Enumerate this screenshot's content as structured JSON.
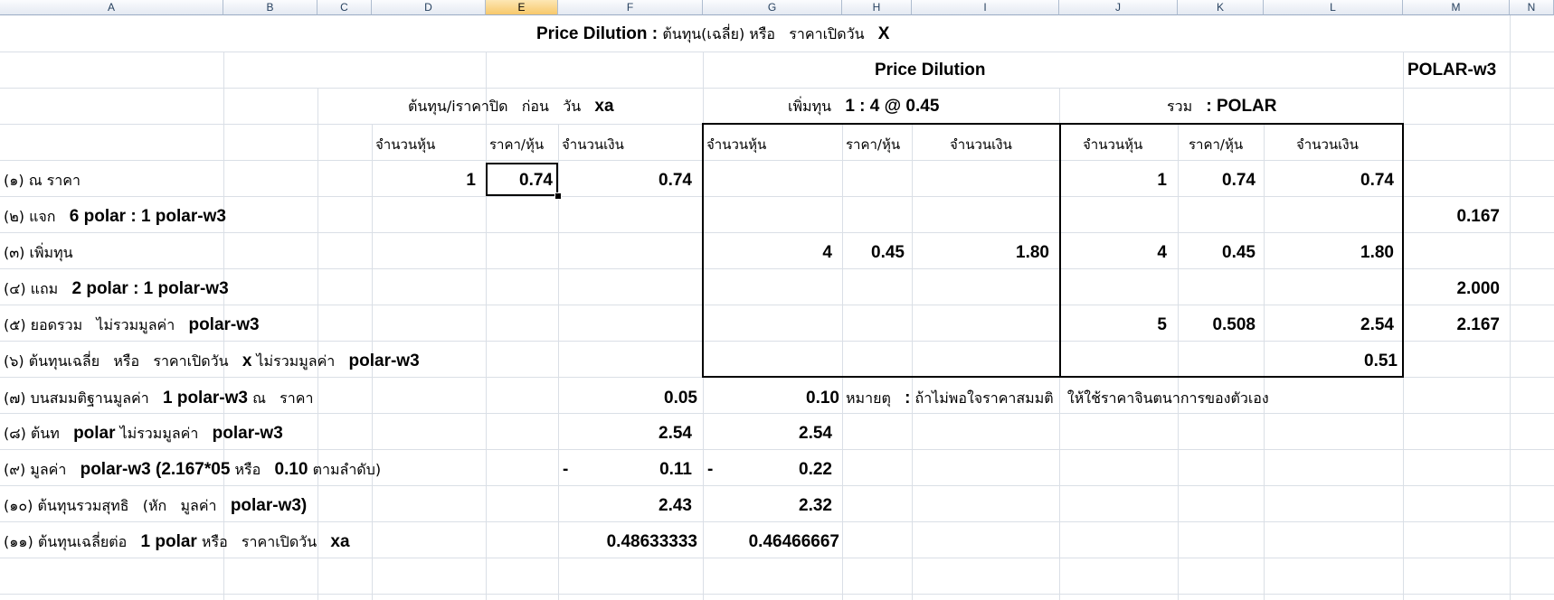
{
  "columns": [
    "A",
    "B",
    "C",
    "D",
    "E",
    "F",
    "G",
    "H",
    "I",
    "J",
    "K",
    "L",
    "M",
    "N"
  ],
  "title": {
    "en": "Price Dilution",
    "sep": " : ",
    "rest": "ต้นทุน(เฉลี่ย) หรือ   ราคาเปิดวัน   ",
    "x": "X"
  },
  "row2": {
    "price_dilution": "Price Dilution",
    "polar_w3": "POLAR-w3"
  },
  "row3": {
    "left_label": "ต้นทุน/iราคาปิด   ก่อน   วัน",
    "left_xa": "xa",
    "mid_label": "เพิ่มทุน",
    "mid_ratio": "1 : 4 @ 0.45",
    "right_label": "รวม",
    "right_polar": ": POLAR"
  },
  "headers": {
    "d": "จำนวนหุ้น",
    "e": "ราคา/หุ้น",
    "f": "จำนวนเงิน",
    "g": "จำนวนหุ้น",
    "h": "ราคา/หุ้น",
    "i": "จำนวนเงิน",
    "j": "จำนวนหุ้น",
    "k": "ราคา/หุ้น",
    "l": "จำนวนเงิน"
  },
  "rows": {
    "r1": {
      "a_th": "(๑) ณ   ราคา",
      "d": "1",
      "e": "0.74",
      "f": "0.74",
      "j": "1",
      "k": "0.74",
      "l": "0.74"
    },
    "r2": {
      "a_th": "(๒) แจก",
      "a_en": "6 polar : 1 polar-w3",
      "m": "0.167"
    },
    "r3": {
      "a_th": "(๓) เพิ่มทุน",
      "g": "4",
      "h": "0.45",
      "i": "1.80",
      "j": "4",
      "k": "0.45",
      "l": "1.80"
    },
    "r4": {
      "a_th": "(๔) แถม",
      "a_en": "2 polar : 1 polar-w3",
      "m": "2.000"
    },
    "r5": {
      "a_th": "(๕) ยอดรวม   ไม่รวมมูลค่า",
      "a_en": "polar-w3",
      "j": "5",
      "k": "0.508",
      "l": "2.54",
      "m": "2.167"
    },
    "r6": {
      "a_th": "(๖) ต้นทุนเฉลี่ย   หรือ   ราคาเปิดวัน",
      "a_x": "x",
      "a_th2": "ไม่รวมมูลค่า",
      "a_en": "polar-w3",
      "l": "0.51"
    },
    "r7": {
      "a_th": "(๗) บนสมมติฐานมูลค่า",
      "a_en": "1 polar-w3",
      "a_th2": "ณ   ราคา",
      "f": "0.05",
      "g": "0.10",
      "note_label": "หมายตุ",
      "note_colon": ":",
      "note_text": "ถ้าไม่พอใจราคาสมมติ   ให้ใช้ราคาจินตนาการของตัวเอง"
    },
    "r8": {
      "a_th": "(๘) ต้นท",
      "a_en": "polar",
      "a_th2": "ไม่รวมมูลค่า",
      "a_en2": "polar-w3",
      "f": "2.54",
      "g": "2.54"
    },
    "r9": {
      "a_th": "(๙) มูลค่า",
      "a_en": "polar-w3 (2.167*05",
      "a_th2": "หรือ",
      "a_en2": "0.10",
      "a_th3": "ตามลำดับ)",
      "f_dash": "-",
      "f": "0.11",
      "g_dash": "-",
      "g": "0.22"
    },
    "r10": {
      "a_th": "(๑๐) ต้นทุนรวมสุทธิ   (หัก   มูลค่า",
      "a_en": "polar-w3)",
      "f": "2.43",
      "g": "2.32"
    },
    "r11": {
      "a_th": "(๑๑) ต้นทุนเฉลี่ยต่อ",
      "a_en": "1 polar",
      "a_th2": "หรือ   ราคาเปิดวัน",
      "a_en2": "xa",
      "f": "0.48633333",
      "g": "0.46466667"
    }
  }
}
